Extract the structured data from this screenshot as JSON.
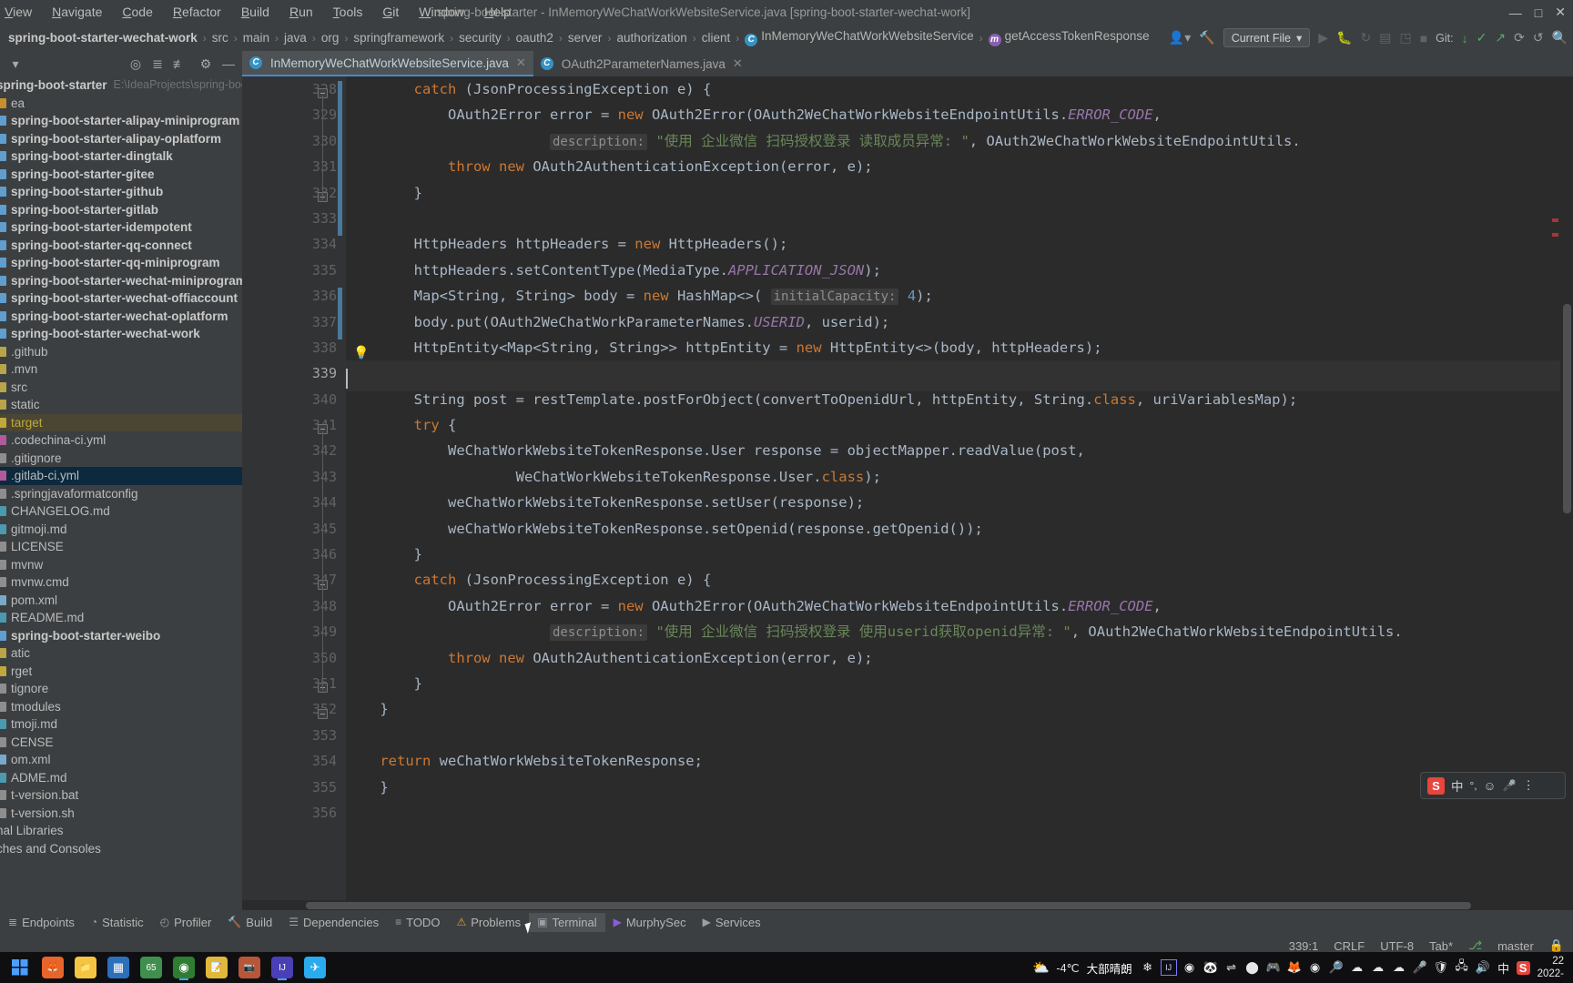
{
  "window": {
    "title": "spring-boot-starter - InMemoryWeChatWorkWebsiteService.java [spring-boot-starter-wechat-work]",
    "minimize": "—",
    "maximize": "□",
    "close": "✕"
  },
  "menu": {
    "items": [
      "View",
      "Navigate",
      "Code",
      "Refactor",
      "Build",
      "Run",
      "Tools",
      "Git",
      "Window",
      "Help"
    ]
  },
  "breadcrumb": {
    "items": [
      "spring-boot-starter-wechat-work",
      "src",
      "main",
      "java",
      "org",
      "springframework",
      "security",
      "oauth2",
      "server",
      "authorization",
      "client"
    ],
    "class_item": "InMemoryWeChatWorkWebsiteService",
    "method_item": "getAccessTokenResponse",
    "separator": "›"
  },
  "toolbar": {
    "run_config": "Current File",
    "dropdown_caret": "▾",
    "git_label": "Git:",
    "avatar_icon": "account-icon",
    "hammer_icon": "build-icon",
    "run_icon": "▶",
    "debug_icon": "🐞",
    "rerun_icon": "↻",
    "coverage_icon": "▤",
    "profile_icon": "◳",
    "stop_icon": "■",
    "update_icon": "↓",
    "commit_icon": "✓",
    "push_icon": "↗",
    "history_icon": "⟳",
    "undo_icon": "↺",
    "search_icon": "🔍"
  },
  "sidebar": {
    "toolbar_icons": [
      "collapse-caret",
      "locate-icon",
      "expand-all-icon",
      "collapse-all-icon",
      "settings-gear-icon",
      "hide-icon"
    ],
    "tree": [
      {
        "label": "spring-boot-starter",
        "path": "E:\\IdeaProjects\\spring-boot-star",
        "bold": true,
        "kind": "module",
        "indent": 0
      },
      {
        "label": "ea",
        "kind": "folder-orange",
        "indent": 1,
        "clipped": true
      },
      {
        "label": "spring-boot-starter-alipay-miniprogram",
        "bold": true,
        "kind": "module",
        "indent": 1
      },
      {
        "label": "spring-boot-starter-alipay-oplatform",
        "bold": true,
        "kind": "module",
        "indent": 1
      },
      {
        "label": "spring-boot-starter-dingtalk",
        "bold": true,
        "kind": "module",
        "indent": 1
      },
      {
        "label": "spring-boot-starter-gitee",
        "bold": true,
        "kind": "module",
        "indent": 1
      },
      {
        "label": "spring-boot-starter-github",
        "bold": true,
        "kind": "module",
        "indent": 1
      },
      {
        "label": "spring-boot-starter-gitlab",
        "bold": true,
        "kind": "module",
        "indent": 1
      },
      {
        "label": "spring-boot-starter-idempotent",
        "bold": true,
        "kind": "module",
        "indent": 1
      },
      {
        "label": "spring-boot-starter-qq-connect",
        "bold": true,
        "kind": "module",
        "indent": 1
      },
      {
        "label": "spring-boot-starter-qq-miniprogram",
        "bold": true,
        "kind": "module",
        "indent": 1
      },
      {
        "label": "spring-boot-starter-wechat-miniprogram",
        "bold": true,
        "kind": "module",
        "indent": 1
      },
      {
        "label": "spring-boot-starter-wechat-offiaccount",
        "bold": true,
        "kind": "module",
        "indent": 1
      },
      {
        "label": "spring-boot-starter-wechat-oplatform",
        "bold": true,
        "kind": "module",
        "indent": 1
      },
      {
        "label": "spring-boot-starter-wechat-work",
        "bold": true,
        "kind": "module",
        "indent": 1
      },
      {
        "label": ".github",
        "kind": "folder",
        "indent": 1
      },
      {
        "label": ".mvn",
        "kind": "folder",
        "indent": 1
      },
      {
        "label": "src",
        "kind": "folder",
        "indent": 1
      },
      {
        "label": "static",
        "kind": "folder",
        "indent": 1
      },
      {
        "label": "target",
        "kind": "folder-excluded",
        "indent": 1,
        "highlight": true
      },
      {
        "label": ".codechina-ci.yml",
        "kind": "yml",
        "indent": 1
      },
      {
        "label": ".gitignore",
        "kind": "file",
        "indent": 1
      },
      {
        "label": ".gitlab-ci.yml",
        "kind": "yml",
        "indent": 1,
        "selected": true
      },
      {
        "label": ".springjavaformatconfig",
        "kind": "file",
        "indent": 1
      },
      {
        "label": "CHANGELOG.md",
        "kind": "md",
        "indent": 1
      },
      {
        "label": "gitmoji.md",
        "kind": "md",
        "indent": 1
      },
      {
        "label": "LICENSE",
        "kind": "file",
        "indent": 1
      },
      {
        "label": "mvnw",
        "kind": "file",
        "indent": 1
      },
      {
        "label": "mvnw.cmd",
        "kind": "file",
        "indent": 1
      },
      {
        "label": "pom.xml",
        "kind": "xml",
        "indent": 1
      },
      {
        "label": "README.md",
        "kind": "md",
        "indent": 1
      },
      {
        "label": "spring-boot-starter-weibo",
        "bold": true,
        "kind": "module",
        "indent": 1
      },
      {
        "label": "atic",
        "kind": "folder",
        "indent": 1,
        "clipped": true
      },
      {
        "label": "rget",
        "kind": "folder-excluded",
        "indent": 1,
        "clipped": true
      },
      {
        "label": "tignore",
        "kind": "file",
        "indent": 1,
        "clipped": true
      },
      {
        "label": "tmodules",
        "kind": "file",
        "indent": 1,
        "clipped": true
      },
      {
        "label": "tmoji.md",
        "kind": "md",
        "indent": 1,
        "clipped": true
      },
      {
        "label": "CENSE",
        "kind": "file",
        "indent": 1,
        "clipped": true
      },
      {
        "label": "om.xml",
        "kind": "xml",
        "indent": 1,
        "clipped": true
      },
      {
        "label": "ADME.md",
        "kind": "md",
        "indent": 1,
        "clipped": true
      },
      {
        "label": "t-version.bat",
        "kind": "file",
        "indent": 1,
        "clipped": true
      },
      {
        "label": "t-version.sh",
        "kind": "file",
        "indent": 1,
        "clipped": true
      },
      {
        "label": "nal Libraries",
        "kind": "lib",
        "indent": 0,
        "clipped": true
      },
      {
        "label": "ches and Consoles",
        "kind": "scratch",
        "indent": 0,
        "clipped": true
      }
    ]
  },
  "editor": {
    "tabs": [
      {
        "label": "InMemoryWeChatWorkWebsiteService.java",
        "icon": "class-icon",
        "active": true,
        "close": "✕"
      },
      {
        "label": "OAuth2ParameterNames.java",
        "icon": "class-icon",
        "active": false,
        "close": "✕"
      }
    ],
    "first_line_number": 328,
    "current_line": 339,
    "lines": [
      {
        "n": 328,
        "indent": 2,
        "tokens": [
          {
            "t": "catch",
            "c": "kw"
          },
          {
            "t": " (JsonProcessingException e) {",
            "c": "pl"
          }
        ]
      },
      {
        "n": 329,
        "indent": 3,
        "tokens": [
          {
            "t": "OAuth2Error error = ",
            "c": "pl"
          },
          {
            "t": "new",
            "c": "kw"
          },
          {
            "t": " OAuth2Error(OAuth2WeChatWorkWebsiteEndpointUtils.",
            "c": "pl"
          },
          {
            "t": "ERROR_CODE",
            "c": "fld"
          },
          {
            "t": ",",
            "c": "pl"
          }
        ]
      },
      {
        "n": 330,
        "indent": 6,
        "tokens": [
          {
            "t": "description:",
            "c": "hint"
          },
          {
            "t": " \"使用 企业微信 扫码授权登录 读取成员异常: \"",
            "c": "str"
          },
          {
            "t": ", OAuth2WeChatWorkWebsiteEndpointUtils.",
            "c": "pl"
          }
        ]
      },
      {
        "n": 331,
        "indent": 3,
        "tokens": [
          {
            "t": "throw",
            "c": "kw"
          },
          {
            "t": " ",
            "c": "pl"
          },
          {
            "t": "new",
            "c": "kw"
          },
          {
            "t": " OAuth2AuthenticationException(error, e);",
            "c": "pl"
          }
        ]
      },
      {
        "n": 332,
        "indent": 2,
        "tokens": [
          {
            "t": "}",
            "c": "pl"
          }
        ]
      },
      {
        "n": 333,
        "indent": 0,
        "tokens": []
      },
      {
        "n": 334,
        "indent": 2,
        "tokens": [
          {
            "t": "HttpHeaders httpHeaders = ",
            "c": "pl"
          },
          {
            "t": "new",
            "c": "kw"
          },
          {
            "t": " HttpHeaders();",
            "c": "pl"
          }
        ]
      },
      {
        "n": 335,
        "indent": 2,
        "tokens": [
          {
            "t": "httpHeaders.setContentType(MediaType.",
            "c": "pl"
          },
          {
            "t": "APPLICATION_JSON",
            "c": "fld"
          },
          {
            "t": ");",
            "c": "pl"
          }
        ]
      },
      {
        "n": 336,
        "indent": 2,
        "tokens": [
          {
            "t": "Map<String, String> body = ",
            "c": "pl"
          },
          {
            "t": "new",
            "c": "kw"
          },
          {
            "t": " HashMap<>( ",
            "c": "pl"
          },
          {
            "t": "initialCapacity:",
            "c": "hint"
          },
          {
            "t": " ",
            "c": "pl"
          },
          {
            "t": "4",
            "c": "num"
          },
          {
            "t": ");",
            "c": "pl"
          }
        ]
      },
      {
        "n": 337,
        "indent": 2,
        "tokens": [
          {
            "t": "body.put(OAuth2WeChatWorkParameterNames.",
            "c": "pl"
          },
          {
            "t": "USERID",
            "c": "fld"
          },
          {
            "t": ", userid);",
            "c": "pl"
          }
        ]
      },
      {
        "n": 338,
        "indent": 2,
        "tokens": [
          {
            "t": "HttpEntity<Map<String, String>> httpEntity = ",
            "c": "pl"
          },
          {
            "t": "new",
            "c": "kw"
          },
          {
            "t": " HttpEntity<>(body, httpHeaders);",
            "c": "pl"
          }
        ]
      },
      {
        "n": 339,
        "indent": 0,
        "tokens": [],
        "current": true
      },
      {
        "n": 340,
        "indent": 2,
        "tokens": [
          {
            "t": "String post = restTemplate.postForObject(convertToOpenidUrl, httpEntity, String.",
            "c": "pl"
          },
          {
            "t": "class",
            "c": "kw"
          },
          {
            "t": ", uriVariablesMap);",
            "c": "pl"
          }
        ]
      },
      {
        "n": 341,
        "indent": 2,
        "tokens": [
          {
            "t": "try",
            "c": "kw"
          },
          {
            "t": " {",
            "c": "pl"
          }
        ]
      },
      {
        "n": 342,
        "indent": 3,
        "tokens": [
          {
            "t": "WeChatWorkWebsiteTokenResponse.User response = objectMapper.readValue(post,",
            "c": "pl"
          }
        ]
      },
      {
        "n": 343,
        "indent": 5,
        "tokens": [
          {
            "t": "WeChatWorkWebsiteTokenResponse.User.",
            "c": "pl"
          },
          {
            "t": "class",
            "c": "kw"
          },
          {
            "t": ");",
            "c": "pl"
          }
        ]
      },
      {
        "n": 344,
        "indent": 3,
        "tokens": [
          {
            "t": "weChatWorkWebsiteTokenResponse.setUser(response);",
            "c": "pl"
          }
        ]
      },
      {
        "n": 345,
        "indent": 3,
        "tokens": [
          {
            "t": "weChatWorkWebsiteTokenResponse.setOpenid(response.getOpenid());",
            "c": "pl"
          }
        ]
      },
      {
        "n": 346,
        "indent": 2,
        "tokens": [
          {
            "t": "}",
            "c": "pl"
          }
        ]
      },
      {
        "n": 347,
        "indent": 2,
        "tokens": [
          {
            "t": "catch",
            "c": "kw"
          },
          {
            "t": " (JsonProcessingException e) {",
            "c": "pl"
          }
        ]
      },
      {
        "n": 348,
        "indent": 3,
        "tokens": [
          {
            "t": "OAuth2Error error = ",
            "c": "pl"
          },
          {
            "t": "new",
            "c": "kw"
          },
          {
            "t": " OAuth2Error(OAuth2WeChatWorkWebsiteEndpointUtils.",
            "c": "pl"
          },
          {
            "t": "ERROR_CODE",
            "c": "fld"
          },
          {
            "t": ",",
            "c": "pl"
          }
        ]
      },
      {
        "n": 349,
        "indent": 6,
        "tokens": [
          {
            "t": "description:",
            "c": "hint"
          },
          {
            "t": " \"使用 企业微信 扫码授权登录 使用userid获取openid异常: \"",
            "c": "str"
          },
          {
            "t": ", OAuth2WeChatWorkWebsiteEndpointUtils.",
            "c": "pl"
          }
        ]
      },
      {
        "n": 350,
        "indent": 3,
        "tokens": [
          {
            "t": "throw",
            "c": "kw"
          },
          {
            "t": " ",
            "c": "pl"
          },
          {
            "t": "new",
            "c": "kw"
          },
          {
            "t": " OAuth2AuthenticationException(error, e);",
            "c": "pl"
          }
        ]
      },
      {
        "n": 351,
        "indent": 2,
        "tokens": [
          {
            "t": "}",
            "c": "pl"
          }
        ]
      },
      {
        "n": 352,
        "indent": 1,
        "tokens": [
          {
            "t": "}",
            "c": "pl"
          }
        ]
      },
      {
        "n": 353,
        "indent": 0,
        "tokens": []
      },
      {
        "n": 354,
        "indent": 1,
        "tokens": [
          {
            "t": "return",
            "c": "kw"
          },
          {
            "t": " weChatWorkWebsiteTokenResponse;",
            "c": "pl"
          }
        ]
      },
      {
        "n": 355,
        "indent": 0,
        "tokens": [
          {
            "t": "    }",
            "c": "pl"
          }
        ]
      },
      {
        "n": 356,
        "indent": 0,
        "tokens": []
      }
    ]
  },
  "ime": {
    "app_icon": "sogou-icon",
    "mode": "中",
    "punct_icon": "°,",
    "emoji_icon": "☺",
    "mic_icon": "🎤",
    "menu_icon": "⋮"
  },
  "bottom_toolbar": {
    "items": [
      {
        "label": "Endpoints",
        "icon": "endpoints-icon",
        "active": false
      },
      {
        "label": "Statistic",
        "icon": "statistic-icon",
        "active": false
      },
      {
        "label": "Profiler",
        "icon": "profiler-icon",
        "active": false
      },
      {
        "label": "Build",
        "icon": "build-hammer-icon",
        "active": false
      },
      {
        "label": "Dependencies",
        "icon": "dependencies-icon",
        "active": false
      },
      {
        "label": "TODO",
        "icon": "todo-icon",
        "active": false
      },
      {
        "label": "Problems",
        "icon": "problems-icon",
        "active": false
      },
      {
        "label": "Terminal",
        "icon": "terminal-icon",
        "active": true
      },
      {
        "label": "MurphySec",
        "icon": "murphysec-icon",
        "active": false
      },
      {
        "label": "Services",
        "icon": "services-icon",
        "active": false
      }
    ]
  },
  "statusbar": {
    "caret_position": "339:1",
    "line_separator": "CRLF",
    "encoding": "UTF-8",
    "indent": "Tab*",
    "branch": "master",
    "branch_icon": "git-branch-icon",
    "lock_icon": "🔒"
  },
  "taskbar": {
    "start_icon": "windows-start-icon",
    "apps": [
      {
        "name": "firefox-icon",
        "glyph": "🦊",
        "bg": "#e8642a",
        "running": false
      },
      {
        "name": "file-explorer-icon",
        "glyph": "📁",
        "bg": "#f5c542",
        "running": false
      },
      {
        "name": "microsoft-store-icon",
        "glyph": "▦",
        "bg": "#2c6fbb",
        "running": false
      },
      {
        "name": "battery-65-icon",
        "glyph": "65",
        "bg": "#3f8f4f",
        "running": false
      },
      {
        "name": "chrome-icon",
        "glyph": "◉",
        "bg": "#2e7d32",
        "running": true
      },
      {
        "name": "note-icon",
        "glyph": "📝",
        "bg": "#e0b83a",
        "running": false
      },
      {
        "name": "camera-icon",
        "glyph": "📷",
        "bg": "#b8563a",
        "running": false
      },
      {
        "name": "intellij-idea-icon",
        "glyph": "IJ",
        "bg": "#4a3fb5",
        "running": true
      },
      {
        "name": "telegram-icon",
        "glyph": "✈",
        "bg": "#2aabee",
        "running": false
      }
    ],
    "weather": {
      "temp": "-4℃",
      "desc": "大部晴朗",
      "icon": "partly-cloudy-icon"
    },
    "tray": [
      {
        "name": "nahimic-icon",
        "glyph": "❄"
      },
      {
        "name": "intellij-tray-icon",
        "glyph": "IJ"
      },
      {
        "name": "green-shield-icon",
        "glyph": "◉"
      },
      {
        "name": "panda-icon",
        "glyph": "🐼"
      },
      {
        "name": "link-icon",
        "glyph": "⇌"
      },
      {
        "name": "record-icon",
        "glyph": "⬤"
      },
      {
        "name": "steam-icon",
        "glyph": "🎮"
      },
      {
        "name": "firefox-tray-icon",
        "glyph": "🦊"
      },
      {
        "name": "chrome-tray-icon",
        "glyph": "◉"
      },
      {
        "name": "search-tray-icon",
        "glyph": "🔎"
      },
      {
        "name": "onedrive-blue-icon",
        "glyph": "☁"
      },
      {
        "name": "onedrive-white-icon",
        "glyph": "☁"
      },
      {
        "name": "onedrive-blue2-icon",
        "glyph": "☁"
      },
      {
        "name": "mic-icon",
        "glyph": "🎤"
      },
      {
        "name": "security-shield-icon",
        "glyph": "🛡"
      },
      {
        "name": "network-icon",
        "glyph": "🖧"
      },
      {
        "name": "volume-icon",
        "glyph": "🔊"
      },
      {
        "name": "ime-zh-icon",
        "glyph": "中"
      },
      {
        "name": "sogou-tray-icon",
        "glyph": "S"
      }
    ],
    "clock": {
      "time": "22",
      "date": "2022-"
    }
  }
}
